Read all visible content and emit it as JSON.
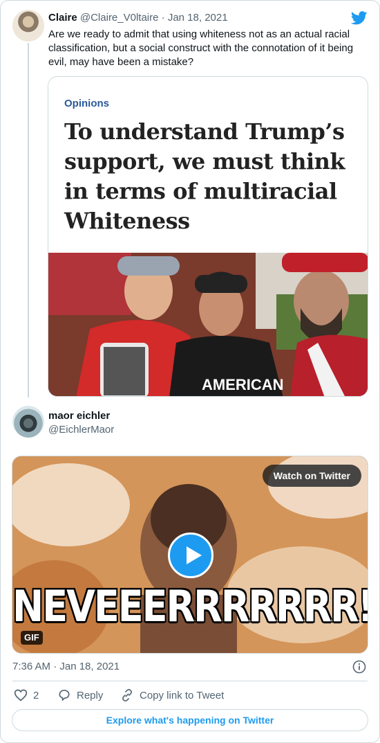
{
  "parent_tweet": {
    "name": "Claire",
    "handle": "@Claire_V0ltaire",
    "date": "Jan 18, 2021",
    "separator": "·",
    "text": "Are we ready to admit that using whiteness not as an actual racial classification, but a social construct with the connotation of it being evil, may have been a mistake?",
    "card": {
      "kicker": "Opinions",
      "headline": "To understand Trump’s support, we must think in terms of multiracial Whiteness",
      "photo_text": "AMERICAN"
    }
  },
  "reply_tweet": {
    "name": "maor eichler",
    "handle": "@EichlerMaor",
    "media": {
      "watch_label": "Watch on Twitter",
      "caption": "NEVEEERRRRRRR!!",
      "badge": "GIF"
    },
    "timestamp": "7:36 AM · Jan 18, 2021",
    "actions": {
      "like_count": "2",
      "reply_label": "Reply",
      "copy_label": "Copy link to Tweet"
    },
    "explore_label": "Explore what's happening on Twitter"
  },
  "icons": {
    "brand": "twitter-bird-icon",
    "info": "info-icon",
    "like": "heart-icon",
    "reply": "reply-icon",
    "copy": "link-icon",
    "play": "play-icon"
  },
  "colors": {
    "accent": "#1d9bf0",
    "muted": "#536471",
    "text": "#0f1419",
    "border": "#cfd9de",
    "kicker": "#2a5a99"
  }
}
